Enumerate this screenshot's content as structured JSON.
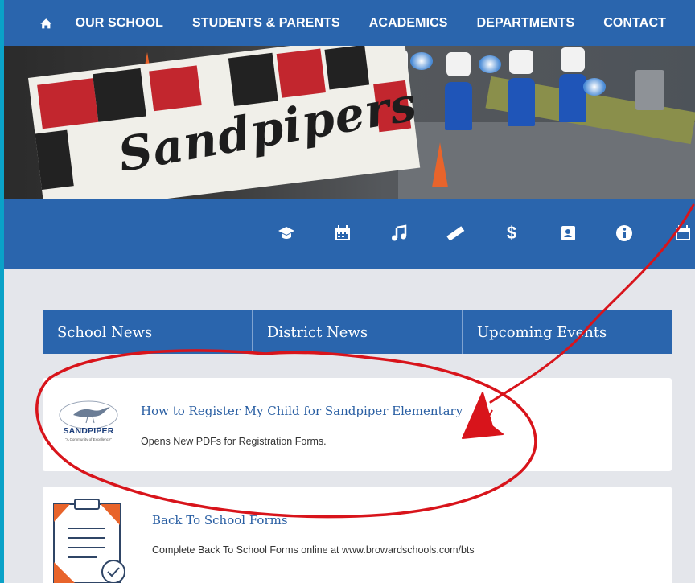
{
  "nav": {
    "home_icon": "home-icon",
    "items": [
      "OUR SCHOOL",
      "STUDENTS & PARENTS",
      "ACADEMICS",
      "DEPARTMENTS",
      "CONTACT"
    ]
  },
  "hero": {
    "banner_text": "Sandpipers"
  },
  "quick_links": [
    "graduation-cap-icon",
    "calendar-icon",
    "music-note-icon",
    "ruler-icon",
    "dollar-icon",
    "address-book-icon",
    "info-icon",
    "calendar-icon"
  ],
  "tabs": [
    "School News",
    "District News",
    "Upcoming Events"
  ],
  "news": [
    {
      "title": "How to Register My Child for Sandpiper Elementary",
      "description": "Opens New PDFs for Registration Forms.",
      "logo_text": "SANDPIPER",
      "logo_tagline": "\"A Community of Excellence\""
    },
    {
      "title": "Back To School Forms",
      "description": "Complete Back To School Forms online at www.browardschools.com/bts",
      "icon": "form-checklist-icon"
    }
  ],
  "colors": {
    "brand_blue": "#2a65ad",
    "page_background": "#e4e6eb",
    "outer_border": "#0aa2c8",
    "annotation_red": "#d8141b",
    "link_blue": "#2a5fa3"
  }
}
